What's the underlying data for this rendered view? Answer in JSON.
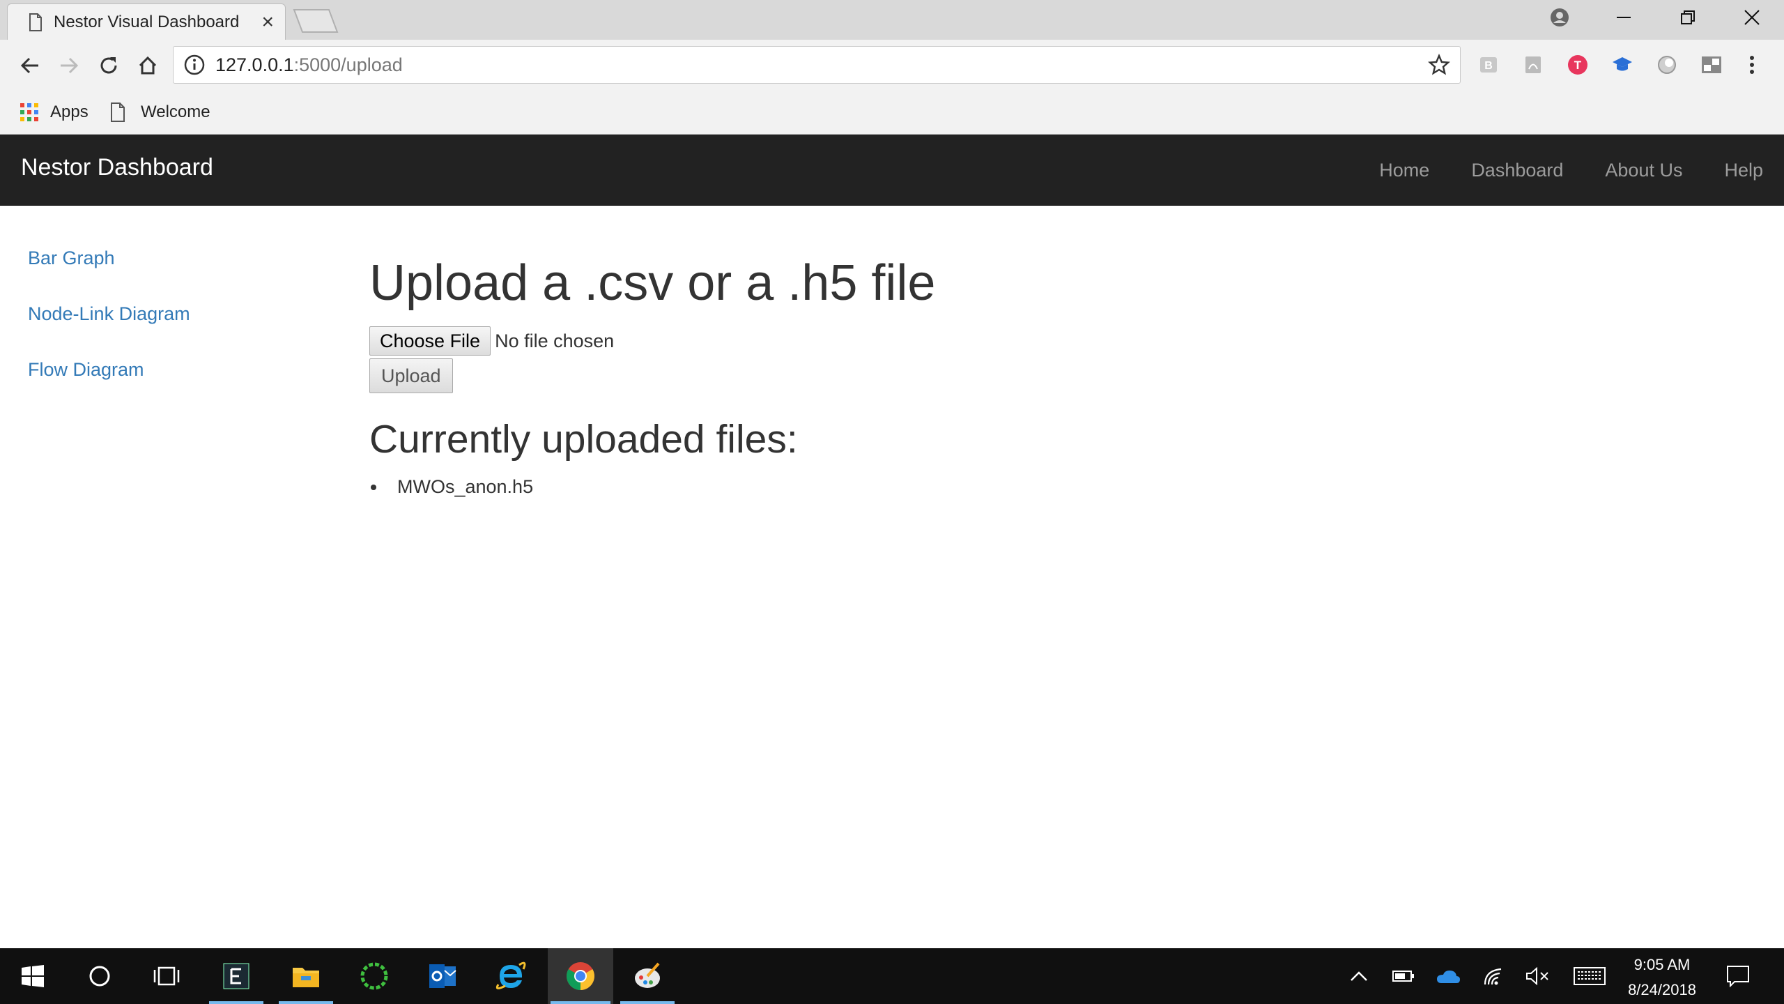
{
  "browser": {
    "tab_title": "Nestor Visual Dashboard",
    "tab_close": "×",
    "url_host": "127.0.0.1",
    "url_path": ":5000/upload",
    "bookmarks": {
      "apps": "Apps",
      "welcome": "Welcome"
    }
  },
  "navbar": {
    "brand": "Nestor Dashboard",
    "links": [
      "Home",
      "Dashboard",
      "About Us",
      "Help"
    ]
  },
  "sidebar": {
    "items": [
      "Bar Graph",
      "Node-Link Diagram",
      "Flow Diagram"
    ]
  },
  "main": {
    "heading": "Upload a .csv or a .h5 file",
    "choose_file_label": "Choose File",
    "no_file_text": "No file chosen",
    "upload_label": "Upload",
    "files_heading": "Currently uploaded files:",
    "files": [
      "MWOs_anon.h5"
    ]
  },
  "taskbar": {
    "time": "9:05 AM",
    "date": "8/24/2018"
  },
  "colors": {
    "navbar_bg": "#222222",
    "link": "#337ab7",
    "taskbar_bg": "#101010",
    "taskbar_active_underline": "#76b9ed"
  }
}
